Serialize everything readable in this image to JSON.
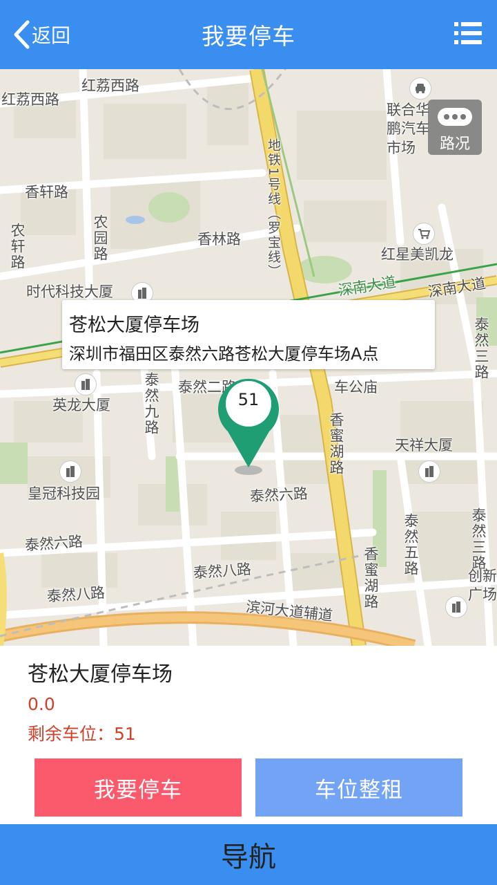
{
  "header": {
    "back_label": "返回",
    "title": "我要停车"
  },
  "map": {
    "traffic_label": "路况",
    "labels": {
      "hongli_1": "红荔西路",
      "hongli_2": "红荔西路",
      "xiangxuan": "香轩路",
      "nongxuan": "农轩路",
      "nongyuan": "农园路",
      "xianglin": "香林路",
      "shidai": "时代科技大厦",
      "metro": "地铁1号线（罗宝线）",
      "lianhe": "联合华鹏汽车市场",
      "hongxing": "红星美凯龙",
      "shennan_1": "深南大道",
      "shennan_2": "深南大道",
      "tairan3": "泰然三路",
      "yinglong": "英龙大厦",
      "tairan9": "泰然九路",
      "tairan2": "泰然二路",
      "chegongmiao": "车公庙",
      "xiangmi_1": "香蜜湖路",
      "xiangmi_2": "香蜜湖路",
      "tianxiang": "天祥大厦",
      "huangguan": "皇冠科技园",
      "tairan6_1": "泰然六路",
      "tairan6_2": "泰然六路",
      "tairan5": "泰然五路",
      "tairan3b": "泰然三路",
      "tairan8_1": "泰然八路",
      "tairan8_2": "泰然八路",
      "chuangxin": "创新广场",
      "binhe": "滨河大道辅道"
    },
    "info_card": {
      "name": "苍松大厦停车场",
      "address": "深圳市福田区泰然六路苍松大厦停车场A点"
    },
    "pin_count": "51",
    "colors": {
      "pin": "#1e9e72",
      "arterial": "#f0d268",
      "metro": "#3aa34a"
    }
  },
  "details": {
    "lot_name": "苍松大厦停车场",
    "rating": "0.0",
    "spaces_label": "剩余车位：",
    "spaces_value": "51",
    "park_button": "我要停车",
    "rent_button": "车位整租"
  },
  "nav_button": "导航"
}
